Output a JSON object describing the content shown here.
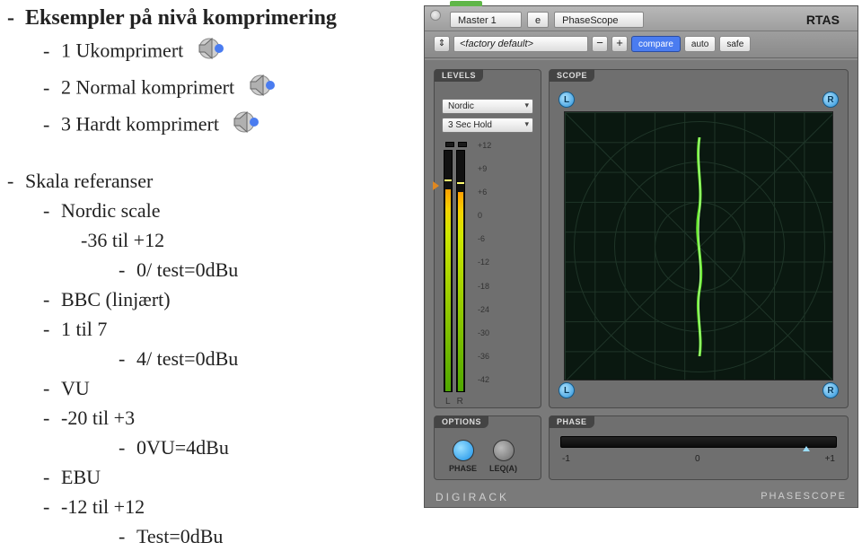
{
  "slide": {
    "heading": "Eksempler på nivå komprimering",
    "items": [
      "1 Ukomprimert",
      "2 Normal komprimert",
      "3 Hardt komprimert"
    ],
    "section2": "Skala referanser",
    "refs": [
      {
        "name": "Nordic scale",
        "range": "-36 til +12",
        "note": "0/ test=0dBu"
      },
      {
        "name": "BBC (linjært)",
        "range": "1 til 7",
        "note": "4/ test=0dBu"
      },
      {
        "name": "VU",
        "range": "-20 til +3",
        "note": "0VU=4dBu"
      },
      {
        "name": "EBU",
        "range": "-12 til +12",
        "note": "Test=0dBu"
      }
    ]
  },
  "plugin": {
    "track": "Master 1",
    "insert": "e",
    "name": "PhaseScope",
    "format_label": "RTAS",
    "preset": "<factory default>",
    "btn_compare": "compare",
    "btn_auto": "auto",
    "btn_safe": "safe",
    "levels_label": "LEVELS",
    "scale_preset": "Nordic",
    "hold_preset": "3 Sec Hold",
    "scale_ticks": [
      "+12",
      "+9",
      "+6",
      "0",
      "-6",
      "-12",
      "-18",
      "-24",
      "-30",
      "-36",
      "-42"
    ],
    "ch_left": "L",
    "ch_right": "R",
    "options_label": "OPTIONS",
    "opt_phase": "PHASE",
    "opt_leq": "LEQ(A)",
    "scope_label": "SCOPE",
    "badge_L": "L",
    "badge_R": "R",
    "phase_label": "PHASE",
    "phase_scale": [
      "-1",
      "0",
      "+1"
    ],
    "footer_left": "DIGIRACK",
    "footer_right": "PHASESCOPE"
  }
}
